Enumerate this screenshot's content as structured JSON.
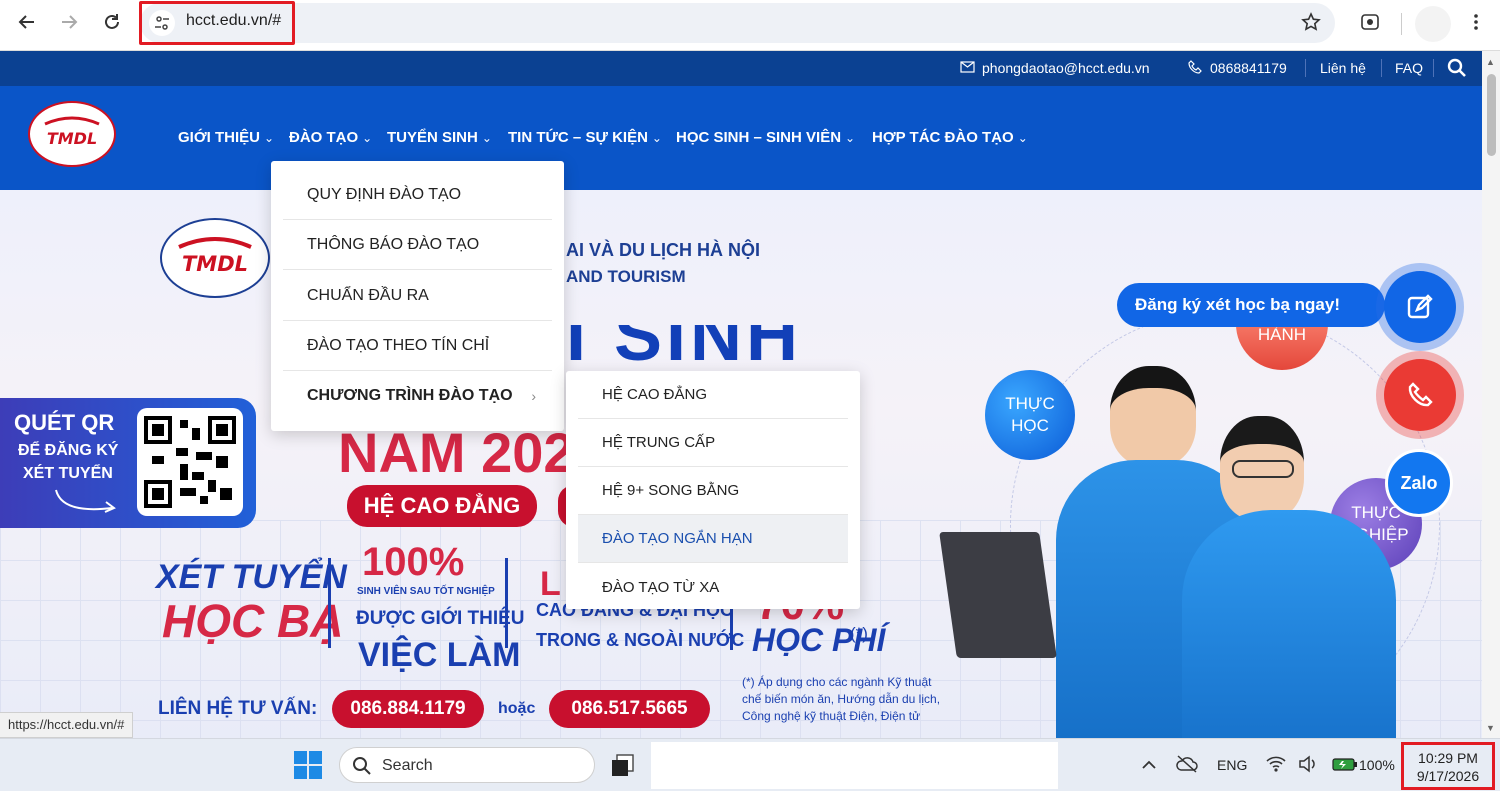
{
  "browser": {
    "url": "hcct.edu.vn/#"
  },
  "topbar": {
    "email": "phongdaotao@hcct.edu.vn",
    "phone": "0868841179",
    "contact": "Liên hệ",
    "faq": "FAQ"
  },
  "nav": {
    "items": [
      {
        "label": "GIỚI THIỆU"
      },
      {
        "label": "ĐÀO TẠO"
      },
      {
        "label": "TUYỂN SINH"
      },
      {
        "label": "TIN TỨC – SỰ KIỆN"
      },
      {
        "label": "HỌC SINH – SINH VIÊN"
      },
      {
        "label": "HỢP TÁC ĐÀO TẠO"
      }
    ],
    "logo_text": "TMDL"
  },
  "dropdown": {
    "items": [
      {
        "label": "QUY ĐỊNH ĐÀO TẠO"
      },
      {
        "label": "THÔNG BÁO ĐÀO TẠO"
      },
      {
        "label": "CHUẨN ĐẦU RA"
      },
      {
        "label": "ĐÀO TẠO THEO TÍN CHỈ"
      },
      {
        "label": "CHƯƠNG TRÌNH ĐÀO TẠO"
      }
    ],
    "submenu": [
      {
        "label": "HỆ CAO ĐẲNG"
      },
      {
        "label": "HỆ TRUNG CẤP"
      },
      {
        "label": "HỆ 9+ SONG BẰNG"
      },
      {
        "label": "ĐÀO TẠO NGẮN HẠN"
      },
      {
        "label": "ĐÀO TẠO TỪ XA"
      }
    ]
  },
  "hero": {
    "school_line1": "AI VÀ DU LỊCH HÀ NỘI",
    "school_line2": "AND TOURISM",
    "big_title": "NAM 202",
    "qr_line1": "QUÉT QR",
    "qr_line2": "ĐỂ ĐĂNG KÝ",
    "qr_line3": "XÉT TUYỂN",
    "pill_cao_dang": "HỆ CAO ĐẲNG",
    "xet_tuyen": "XÉT TUYỂN",
    "hoc_ba": "HỌC BẠ",
    "pct_100": "100%",
    "sv_sau_tn": "SINH VIÊN SAU TỐT NGHIỆP",
    "duoc_gioi_thieu": "ĐƯỢC GIỚI THIỆU",
    "viec_lam": "VIỆC LÀM",
    "lien_thong_1": "CAO ĐẲNG & ĐẠI HỌC",
    "lien_thong_2": "TRONG & NGOÀI NƯỚC",
    "pct_70": "70%",
    "hoc_phi": "HỌC PHÍ",
    "hoc_phi_note": "(*)",
    "footnote_1": "(*) Áp dụng cho các ngành Kỹ thuật",
    "footnote_2": "chế biến món ăn, Hướng dẫn du lịch,",
    "footnote_3": "Công nghệ kỹ thuật Điện, Điện tử",
    "lien_he_tu_van": "LIÊN HỆ TƯ VẤN:",
    "phone1": "086.884.1179",
    "hoac": "hoặc",
    "phone2": "086.517.5665",
    "bubble_thuc_hoc_1": "THỰC",
    "bubble_thuc_hoc_2": "HỌC",
    "bubble_hanh": "HÀNH",
    "bubble_thuc_nghiep_1": "THỰC",
    "bubble_thuc_nghiep_2": "NGHIỆP"
  },
  "floating": {
    "register_label": "Đăng ký xét học bạ ngay!",
    "zalo": "Zalo"
  },
  "status_url": "https://hcct.edu.vn/#",
  "taskbar": {
    "search": "Search",
    "lang": "ENG",
    "battery": "100%",
    "time": "10:29 PM",
    "date": "9/17/2026"
  }
}
